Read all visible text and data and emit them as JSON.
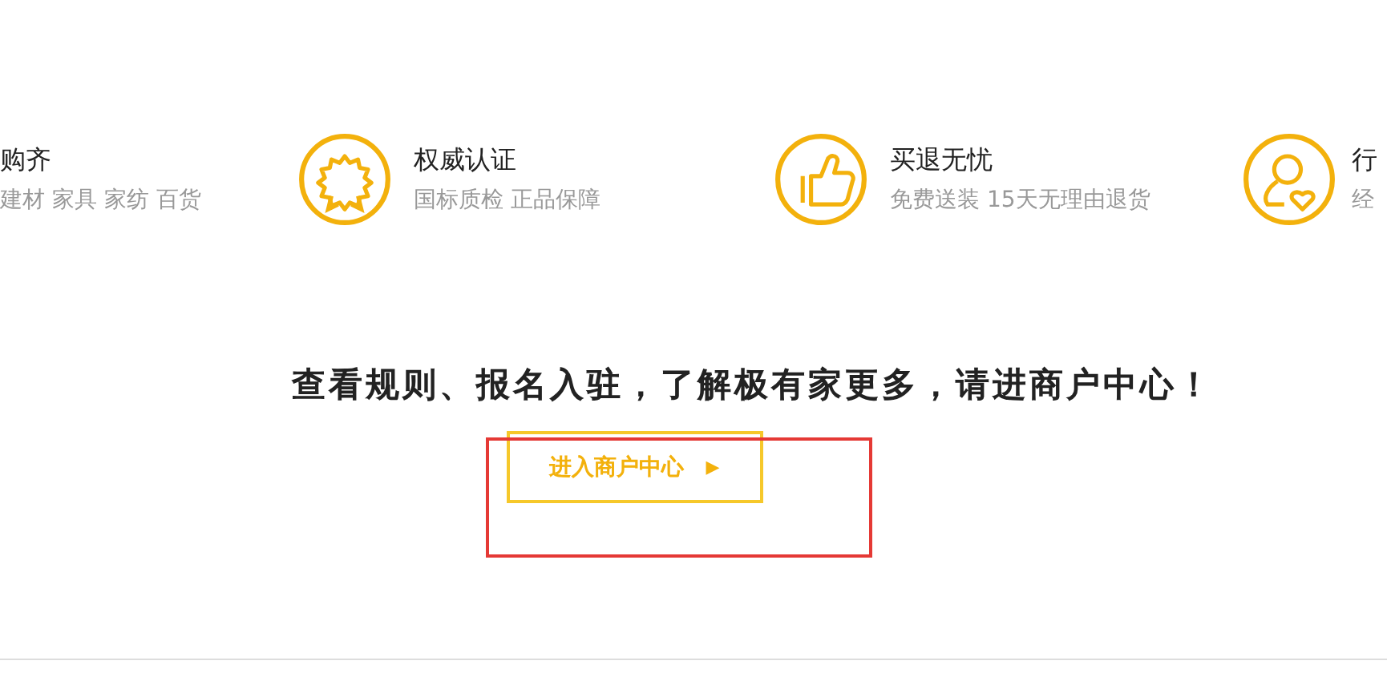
{
  "features": [
    {
      "title": "购齐",
      "subtitle": "建材 家具 家纺 百货"
    },
    {
      "kind": "badge",
      "title": "权威认证",
      "subtitle": "国标质检 正品保障"
    },
    {
      "kind": "thumbs-up",
      "title": "买退无忧",
      "subtitle": "免费送装 15天无理由退货"
    },
    {
      "kind": "person-heart",
      "title": "行",
      "subtitle": "经"
    }
  ],
  "headline": "查看规则、报名入驻，了解极有家更多，请进商户中心！",
  "button": {
    "label": "进入商户中心",
    "arrow": "▶"
  },
  "annotation": {
    "kind": "box"
  }
}
